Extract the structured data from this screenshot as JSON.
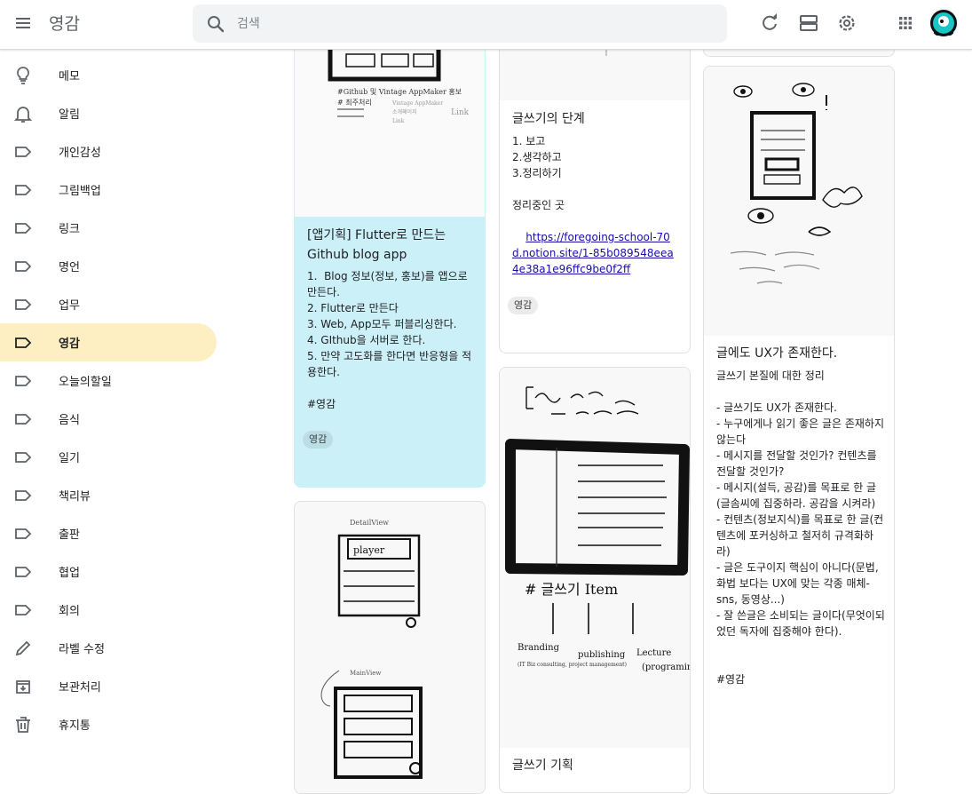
{
  "app": {
    "title": "영감"
  },
  "search": {
    "placeholder": "검색"
  },
  "header_icons": [
    "menu-icon",
    "search-icon",
    "refresh-icon",
    "list-view-icon",
    "settings-icon",
    "apps-icon",
    "account-avatar"
  ],
  "sidebar": {
    "items": [
      {
        "label": "메모",
        "icon": "lightbulb-icon"
      },
      {
        "label": "알림",
        "icon": "bell-icon"
      },
      {
        "label": "개인감성",
        "icon": "label-icon"
      },
      {
        "label": "그림백업",
        "icon": "label-icon"
      },
      {
        "label": "링크",
        "icon": "label-icon"
      },
      {
        "label": "명언",
        "icon": "label-icon"
      },
      {
        "label": "업무",
        "icon": "label-icon"
      },
      {
        "label": "영감",
        "icon": "label-icon",
        "active": true
      },
      {
        "label": "오늘의할일",
        "icon": "label-icon"
      },
      {
        "label": "음식",
        "icon": "label-icon"
      },
      {
        "label": "일기",
        "icon": "label-icon"
      },
      {
        "label": "책리뷰",
        "icon": "label-icon"
      },
      {
        "label": "출판",
        "icon": "label-icon"
      },
      {
        "label": "협업",
        "icon": "label-icon"
      },
      {
        "label": "회의",
        "icon": "label-icon"
      },
      {
        "label": "라벨 수정",
        "icon": "pencil-icon"
      },
      {
        "label": "보관처리",
        "icon": "archive-icon"
      },
      {
        "label": "휴지통",
        "icon": "trash-icon"
      }
    ]
  },
  "notes": {
    "flutter": {
      "title": "[앱기획] Flutter로 만드는 Github blog app",
      "body": "1.  Blog 정보(정보, 홍보)를 앱으로 만든다.\n2. Flutter로 만든다\n3. Web, App모두 퍼블리싱한다.\n4. GIthub을 서버로 한다.\n5. 만약 고도화를 한다면 반응형을 적용한다.\n\n#영감",
      "chip": "영감",
      "color": "#cbf0f8",
      "sketch_text": [
        "#Github 및 Vintage AppMaker 홍보",
        "# 최주처리",
        "Vintage AppMaker",
        "소개페이지",
        "Link",
        "Link"
      ]
    },
    "writing_steps": {
      "title": "글쓰기의 단계",
      "body": "1. 보고\n2.생각하고\n3.정리하기\n\n정리중인 곳",
      "link": "https://foregoing-school-70d.notion.site/1-85b089548eea4e38a1e96ffc9be0f2ff",
      "chip": "영감"
    },
    "writing_plan": {
      "title": "글쓰기 기획",
      "sketch_text": [
        "Branding",
        "publishing",
        "Lecture",
        "(programing)",
        "# 글쓰기 Item",
        "(IT Biz consulting, project management)"
      ]
    },
    "ux": {
      "title": "글에도 UX가 존재한다.",
      "body": "글쓰기 본질에 대한 정리\n\n- 글쓰기도 UX가 존재한다.\n- 누구에게나 읽기 좋은 글은 존재하지 않는다\n- 메시지를 전달할 것인가? 컨텐츠를 전달할 것인가?\n- 메시지(설득, 공감)를 목표로 한 글(글솜씨에 집중하라. 공감을 시켜라)\n- 컨텐츠(정보지식)를 목표로 한 글(컨텐츠에 포커싱하고 철저히 규격화하라)\n- 글은 도구이지 핵심이 아니다(문법, 화법 보다는 UX에 맞는 각종 매체-sns, 동영상...)\n- 잘 쓴글은 소비되는 글이다(무엇이되었던 독자에 집중해야 한다).\n\n\n#영감"
    },
    "player": {
      "sketch_text": [
        "DetailView",
        "player",
        "MainView"
      ]
    }
  }
}
